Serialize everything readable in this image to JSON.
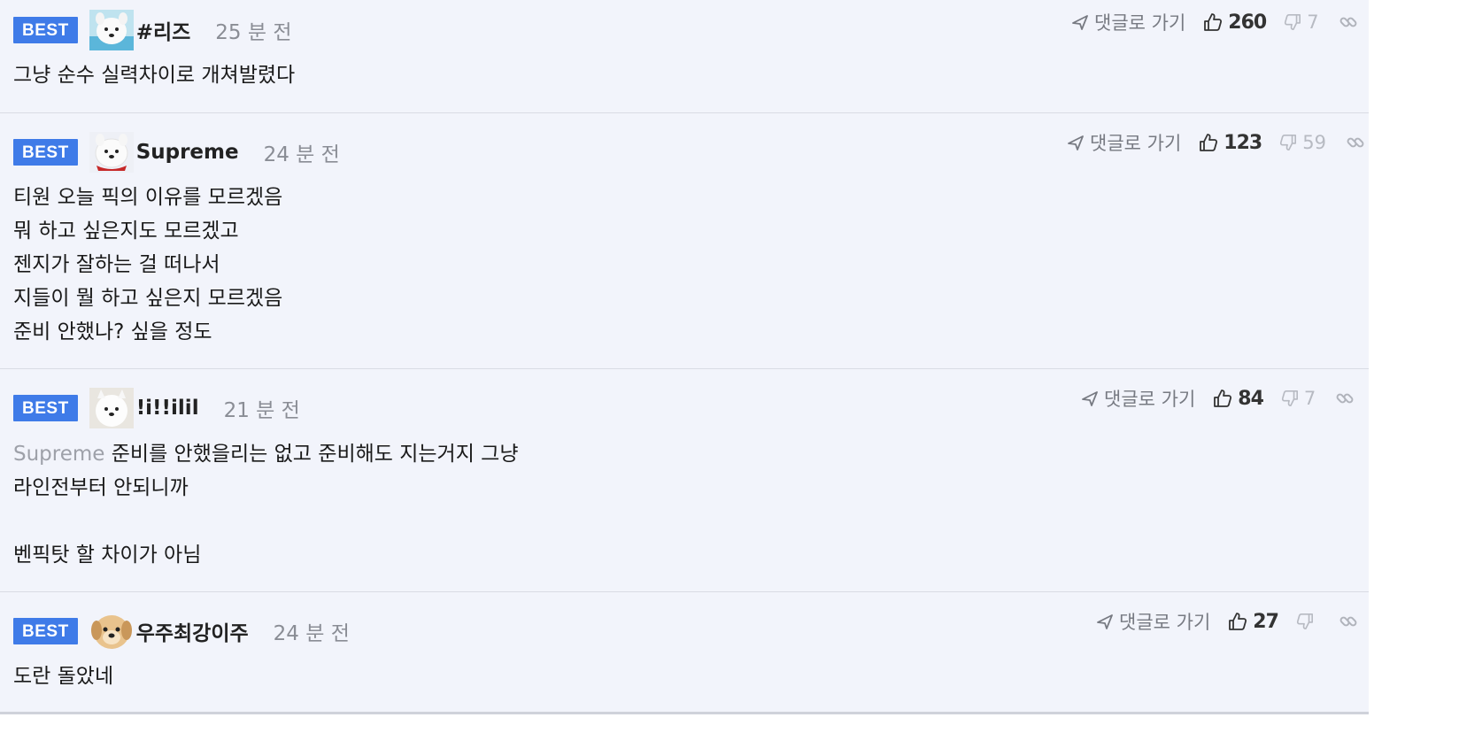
{
  "comments": [
    {
      "badge": "BEST",
      "nickname": "#리즈",
      "time": "25 분 전",
      "reply_label": "댓글로 가기",
      "likes": "260",
      "dislikes": "7",
      "lines": [
        "그냥 순수 실력차이로 개쳐발렸다"
      ],
      "avatar": "samoyed-avatar"
    },
    {
      "badge": "BEST",
      "nickname": "Supreme",
      "time": "24 분 전",
      "reply_label": "댓글로 가기",
      "likes": "123",
      "dislikes": "59",
      "lines": [
        "티원 오늘 픽의 이유를 모르겠음",
        "뭐 하고 싶은지도 모르겠고",
        "젠지가 잘하는 걸 떠나서",
        "지들이 뭘 하고 싶은지 모르겠음",
        "준비 안했나? 싶을 정도"
      ],
      "avatar": "samoyed-avatar"
    },
    {
      "badge": "BEST",
      "nickname": "!i!!ilil",
      "time": "21 분 전",
      "reply_label": "댓글로 가기",
      "likes": "84",
      "dislikes": "7",
      "mention": "Supreme",
      "lines": [
        "준비를 안했을리는 없고 준비해도 지는거지 그냥",
        "라인전부터 안되니까",
        "",
        "벤픽탓 할 차이가 아님"
      ],
      "avatar": "samoyed-avatar"
    },
    {
      "badge": "BEST",
      "nickname": "우주최강이주",
      "time": "24 분 전",
      "reply_label": "댓글로 가기",
      "likes": "27",
      "dislikes": "",
      "lines": [
        "도란 돌았네"
      ],
      "avatar": "puppy-avatar"
    }
  ],
  "colors": {
    "best_badge": "#3f7be8",
    "background": "#f2f4fb",
    "mention": "#9ea1a9",
    "muted": "#8a8d95"
  },
  "icons": {
    "reply": "arrow-send-icon",
    "like": "thumbs-up-icon",
    "dislike": "thumbs-down-icon",
    "link": "link-icon"
  }
}
